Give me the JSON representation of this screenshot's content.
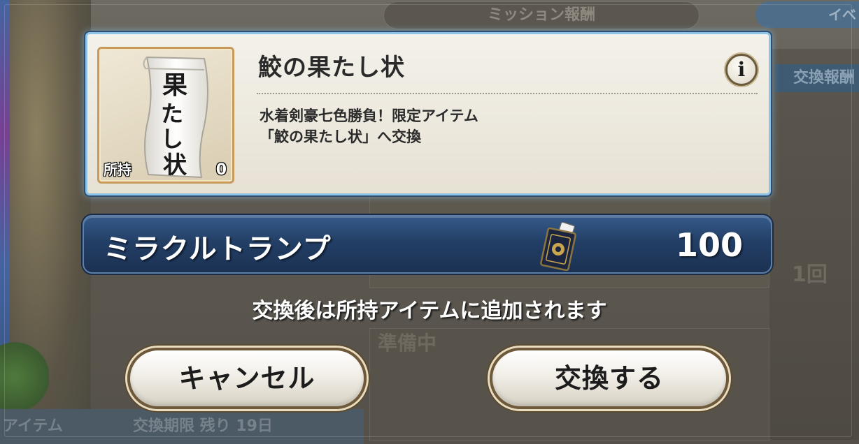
{
  "background": {
    "top_tab": "ミッション報酬",
    "top_right_tab": "イベ",
    "right_header": "交換報酬",
    "faint_texts": [
      "準備中",
      "交換期限 残り 19日",
      "アイテム",
      "1回"
    ]
  },
  "item": {
    "name": "鮫の果たし状",
    "owned_label": "所持",
    "owned_count": "0",
    "description_line1": "水着剣豪七色勝負！限定アイテム",
    "description_line2": "「鮫の果たし状」へ交換",
    "thumb_text": "果たし状",
    "info_symbol": "i"
  },
  "cost": {
    "name": "ミラクルトランプ",
    "amount": "100",
    "icon": "trump-card-icon"
  },
  "notice": "交換後は所持アイテムに追加されます",
  "buttons": {
    "cancel": "キャンセル",
    "exchange": "交換する"
  },
  "colors": {
    "panel_border": "#8ec3e6",
    "cost_bar": "#233f66",
    "button_border": "#6e5a3a"
  }
}
